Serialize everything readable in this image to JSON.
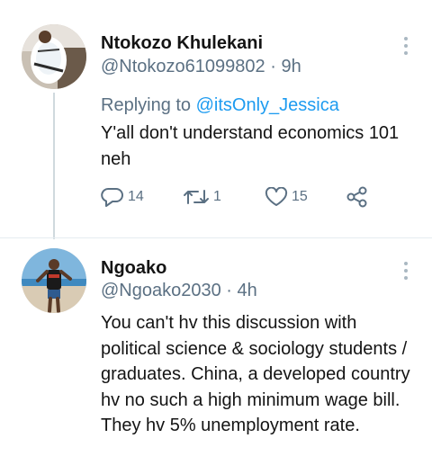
{
  "tweets": [
    {
      "display_name": "Ntokozo Khulekani",
      "handle": "@Ntokozo61099802",
      "separator": "·",
      "time": "9h",
      "replying_prefix": "Replying to",
      "replying_to": "@itsOnly_Jessica",
      "text": "Y'all don't understand economics 101 neh",
      "stats": {
        "replies": "14",
        "retweets": "1",
        "likes": "15"
      }
    },
    {
      "display_name": "Ngoako",
      "handle": "@Ngoako2030",
      "separator": "·",
      "time": "4h",
      "text": "You can't hv this discussion with political science & sociology students / graduates. China, a developed country hv no such a high minimum wage bill. They hv 5% unemployment rate."
    }
  ],
  "colors": {
    "link": "#1d9bf0",
    "secondary": "#5b7083",
    "thread_line": "#cfd9de"
  },
  "icons": [
    "reply-icon",
    "retweet-icon",
    "like-icon",
    "share-icon",
    "more-options-icon"
  ]
}
